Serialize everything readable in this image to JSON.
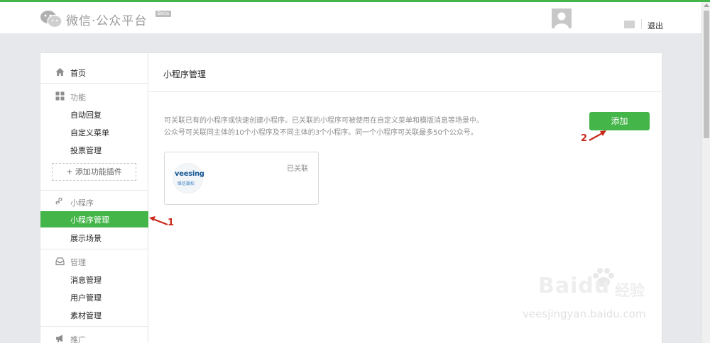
{
  "header": {
    "app_title": "微信·公众平台",
    "beta_badge": "Beta",
    "logout": "退出"
  },
  "sidebar": {
    "home": "首页",
    "group_features": "功能",
    "features_items": [
      "自动回复",
      "自定义菜单",
      "投票管理"
    ],
    "add_plugin": "+ 添加功能插件",
    "group_miniprogram": "小程序",
    "miniprogram_active": "小程序管理",
    "miniprogram_items": [
      "展示场景"
    ],
    "group_manage": "管理",
    "manage_items": [
      "消息管理",
      "用户管理",
      "素材管理"
    ],
    "group_promote": "推广"
  },
  "main": {
    "title": "小程序管理",
    "desc_line1": "可关联已有的小程序或快速创建小程序。已关联的小程序可被使用在自定义菜单和模版消息等场景中。",
    "desc_line2": "公众号可关联同主体的10个小程序及不同主体的3个小程序。同一个小程序可关联最多50个公众号。",
    "add_button": "添加",
    "card": {
      "status": "已关联",
      "logo_text": "veesing",
      "logo_subtext": "维信霸权"
    }
  },
  "annotations": {
    "arrow_1": "1",
    "arrow_2": "2"
  },
  "watermark": {
    "brand": "Baidu",
    "suffix": "经验",
    "url": "veesjingyan.baidu.com"
  },
  "colors": {
    "accent": "#44b549",
    "annotation": "#c9281c"
  }
}
